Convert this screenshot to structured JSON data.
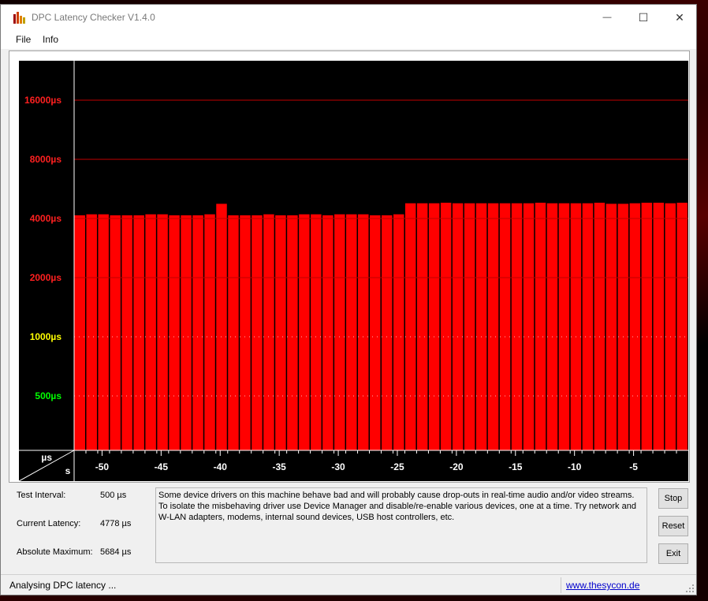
{
  "window": {
    "title": "DPC Latency Checker V1.4.0",
    "minimize_glyph": "—",
    "maximize_glyph": "☐",
    "close_glyph": "✕"
  },
  "menu": {
    "file": "File",
    "info": "Info"
  },
  "info": {
    "test_interval_label": "Test Interval:",
    "test_interval_value": "500 µs",
    "current_latency_label": "Current Latency:",
    "current_latency_value": "4778 µs",
    "absolute_maximum_label": "Absolute Maximum:",
    "absolute_maximum_value": "5684 µs"
  },
  "message": "Some device drivers on this machine behave bad and will probably cause drop-outs in real-time audio and/or video streams. To isolate the misbehaving driver use Device Manager and disable/re-enable various devices, one at a time. Try network and W-LAN adapters, modems, internal sound devices, USB host controllers, etc.",
  "buttons": {
    "stop": "Stop",
    "reset": "Reset",
    "exit": "Exit"
  },
  "status": {
    "text": "Analysing DPC latency ...",
    "link": "www.thesycon.de"
  },
  "colors": {
    "bar": "#ff0000",
    "plot_background": "#000000",
    "red_label": "#ff2020",
    "yellow_label": "#ffff00",
    "green_label": "#00ff00"
  },
  "chart_data": {
    "type": "bar",
    "x_unit_label": "s",
    "y_unit_label": "µs",
    "x_ticks": [
      "-50",
      "-45",
      "-40",
      "-35",
      "-30",
      "-25",
      "-20",
      "-15",
      "-10",
      "-5"
    ],
    "y_ticks": [
      {
        "label": "500µs",
        "value": 500,
        "color": "green"
      },
      {
        "label": "1000µs",
        "value": 1000,
        "color": "yellow"
      },
      {
        "label": "2000µs",
        "value": 2000,
        "color": "red"
      },
      {
        "label": "4000µs",
        "value": 4000,
        "color": "red"
      },
      {
        "label": "8000µs",
        "value": 8000,
        "color": "red"
      },
      {
        "label": "16000µs",
        "value": 16000,
        "color": "red"
      }
    ],
    "y_scale": "log2",
    "x_range": [
      -52,
      0
    ],
    "values": [
      4150,
      4200,
      4200,
      4150,
      4150,
      4150,
      4200,
      4200,
      4150,
      4150,
      4150,
      4200,
      4750,
      4150,
      4150,
      4150,
      4200,
      4150,
      4150,
      4200,
      4200,
      4150,
      4200,
      4200,
      4200,
      4150,
      4150,
      4200,
      4780,
      4780,
      4780,
      4810,
      4780,
      4780,
      4780,
      4780,
      4780,
      4780,
      4780,
      4810,
      4780,
      4780,
      4780,
      4780,
      4810,
      4750,
      4750,
      4780,
      4810,
      4810,
      4780,
      4810
    ]
  }
}
